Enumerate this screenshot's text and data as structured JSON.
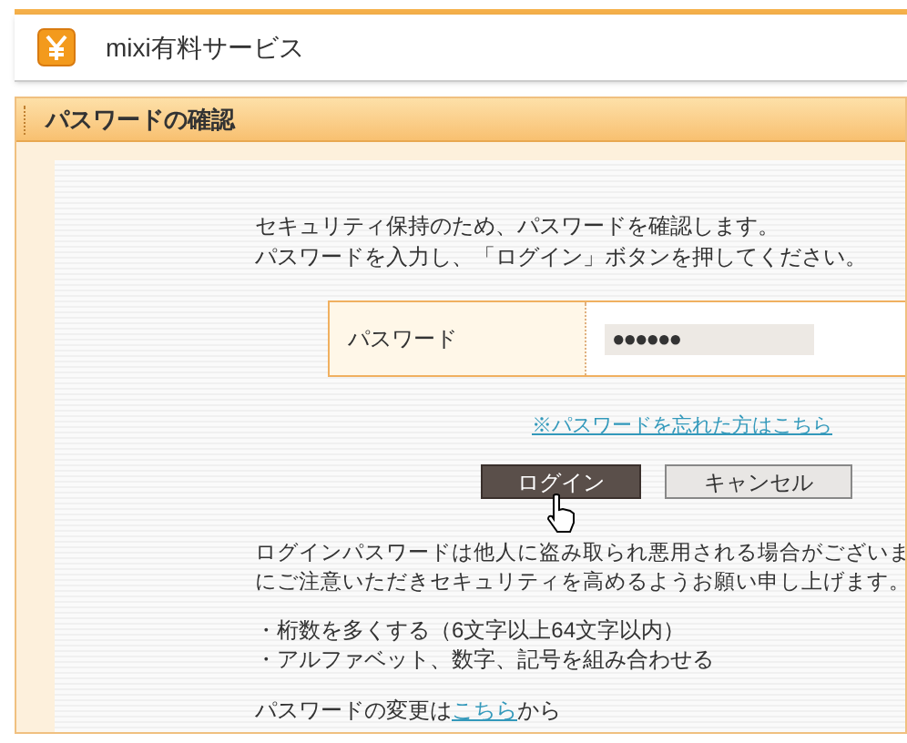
{
  "header": {
    "title": "mixi有料サービス"
  },
  "section": {
    "title": "パスワードの確認"
  },
  "intro": [
    "セキュリティ保持のため、パスワードを確認します。",
    "パスワードを入力し、「ログイン」ボタンを押してください。"
  ],
  "form": {
    "label": "パスワード",
    "value": "●●●●●●"
  },
  "forgot_link": "※パスワードを忘れた方はこちら",
  "buttons": [
    {
      "label": "ログイン",
      "kind": "primary"
    },
    {
      "label": "キャンセル",
      "kind": "secondary"
    }
  ],
  "notice": [
    "ログインパスワードは他人に盗み取られ悪用される場合がございま",
    "にご注意いただきセキュリティを高めるようお願い申し上げます。"
  ],
  "tips": [
    "・桁数を多くする（6文字以上64文字以内）",
    "・アルファベット、数字、記号を組み合わせる"
  ],
  "change": {
    "text": "パスワードの変更は",
    "link": "こちら",
    "suffix": "から"
  }
}
